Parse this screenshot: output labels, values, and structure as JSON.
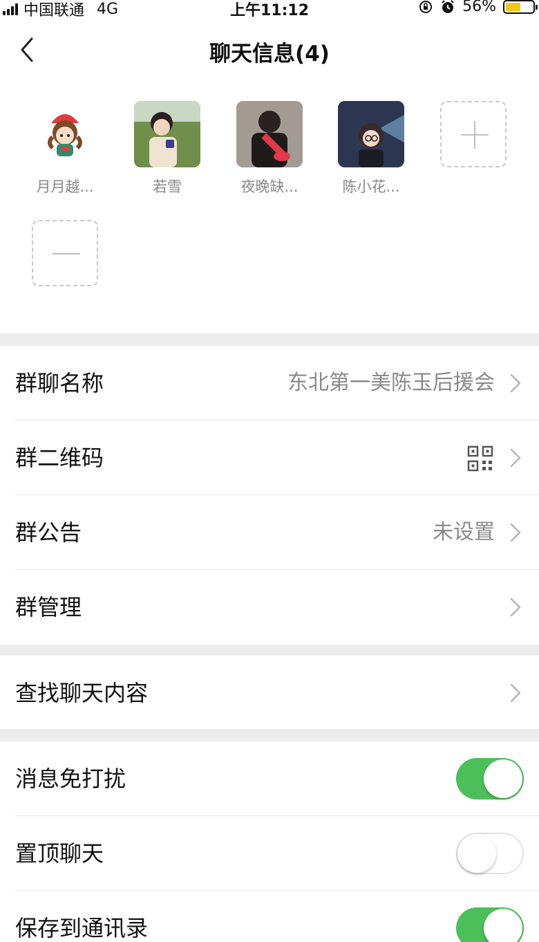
{
  "status_bar": {
    "carrier": "中国联通",
    "network": "4G",
    "time": "上午11:12",
    "battery_percent": "56%",
    "battery_level": 0.56
  },
  "nav": {
    "title": "聊天信息(4)",
    "back_icon": "chevron-left-icon"
  },
  "members": [
    {
      "name": "月月越..."
    },
    {
      "name": "若雪"
    },
    {
      "name": "夜晚缺..."
    },
    {
      "name": "陈小花..."
    }
  ],
  "add_member_icon": "plus-icon",
  "remove_member_icon": "minus-icon",
  "settings": {
    "group_name": {
      "label": "群聊名称",
      "value": "东北第一美陈玉后援会"
    },
    "group_qr": {
      "label": "群二维码",
      "icon": "qr-code-icon"
    },
    "announcement": {
      "label": "群公告",
      "value": "未设置"
    },
    "manage": {
      "label": "群管理"
    },
    "search_history": {
      "label": "查找聊天内容"
    },
    "mute": {
      "label": "消息免打扰",
      "on": true
    },
    "pin": {
      "label": "置顶聊天",
      "on": false
    },
    "save_contacts": {
      "label": "保存到通讯录",
      "on": true
    }
  },
  "colors": {
    "toggle_on": "#4cbf5a",
    "battery": "#f5c518",
    "separator": "#ededed"
  }
}
